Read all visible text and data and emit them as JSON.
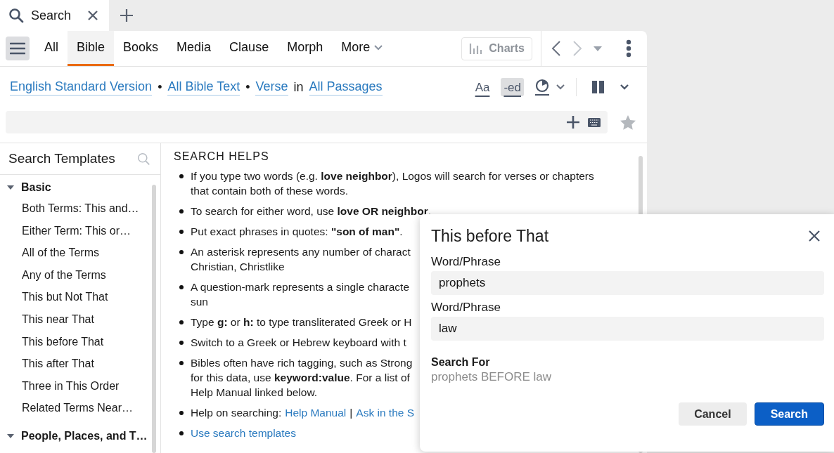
{
  "app_tab": {
    "title": "Search"
  },
  "search_tabs": [
    {
      "label": "All",
      "selected": false
    },
    {
      "label": "Bible",
      "selected": true
    },
    {
      "label": "Books",
      "selected": false
    },
    {
      "label": "Media",
      "selected": false
    },
    {
      "label": "Clause",
      "selected": false
    },
    {
      "label": "Morph",
      "selected": false
    }
  ],
  "more": {
    "label": "More"
  },
  "charts": {
    "label": "Charts",
    "disabled": true
  },
  "scope": [
    {
      "kind": "link",
      "text": "English Standard Version"
    },
    {
      "kind": "sep",
      "text": "•"
    },
    {
      "kind": "link",
      "text": "All Bible Text"
    },
    {
      "kind": "sep",
      "text": "•"
    },
    {
      "kind": "link",
      "text": "Verse"
    },
    {
      "kind": "word",
      "text": "in"
    },
    {
      "kind": "link",
      "text": "All Passages"
    }
  ],
  "toggles": [
    {
      "label": "Aa",
      "on": false
    },
    {
      "label": "-ed",
      "on": true
    }
  ],
  "templates": {
    "title": "Search Templates",
    "groups": [
      {
        "label": "Basic",
        "expanded": true,
        "children": [
          {
            "label": "Both Terms: This and…"
          },
          {
            "label": "Either Term: This or…"
          },
          {
            "label": "All of the Terms"
          },
          {
            "label": "Any of the Terms"
          },
          {
            "label": "This but Not That"
          },
          {
            "label": "This near That"
          },
          {
            "label": "This before That"
          },
          {
            "label": "This after That"
          },
          {
            "label": "Three in This Order"
          },
          {
            "label": "Related Terms Near…"
          }
        ]
      },
      {
        "label": "People, Places, and T…",
        "expanded": true
      }
    ]
  },
  "helps": {
    "title": "SEARCH HELPS",
    "items": [
      {
        "kind": "text",
        "lines": [
          "If you type two words (e.g. **love neighbor**), Logos will search for verses or chapters",
          "that contain both of these words."
        ]
      },
      {
        "kind": "text",
        "lines": [
          "To search for either word, use **love OR neighbor**."
        ]
      },
      {
        "kind": "text",
        "lines": [
          "Put exact phrases in quotes: **\"son of man\"**."
        ]
      },
      {
        "kind": "text",
        "lines": [
          "An asterisk represents any number of charact",
          "Christian, Christlike"
        ]
      },
      {
        "kind": "text",
        "lines": [
          "A question-mark represents a single characte",
          "sun"
        ]
      },
      {
        "kind": "text",
        "lines": [
          "Type **g:** or **h:** to type transliterated Greek or H"
        ]
      },
      {
        "kind": "text",
        "lines": [
          "Switch to a Greek or Hebrew keyboard with t"
        ]
      },
      {
        "kind": "text",
        "lines": [
          "Bibles often have rich tagging, such as Strong",
          "for this data, use **keyword:value**. For a list of",
          "Help Manual linked below."
        ]
      },
      {
        "kind": "links",
        "lead": "Help on searching:",
        "links": [
          "Help Manual",
          "Ask in the S"
        ],
        "separator": "|"
      },
      {
        "kind": "link",
        "text": "Use search templates"
      }
    ]
  },
  "dialog": {
    "title": "This before That",
    "fields": [
      {
        "label": "Word/Phrase",
        "value": "prophets"
      },
      {
        "label": "Word/Phrase",
        "value": "law"
      }
    ],
    "result_label": "Search For",
    "result": "prophets BEFORE law",
    "buttons": [
      {
        "label": "Cancel",
        "kind": "secondary"
      },
      {
        "label": "Search",
        "kind": "primary"
      }
    ]
  }
}
